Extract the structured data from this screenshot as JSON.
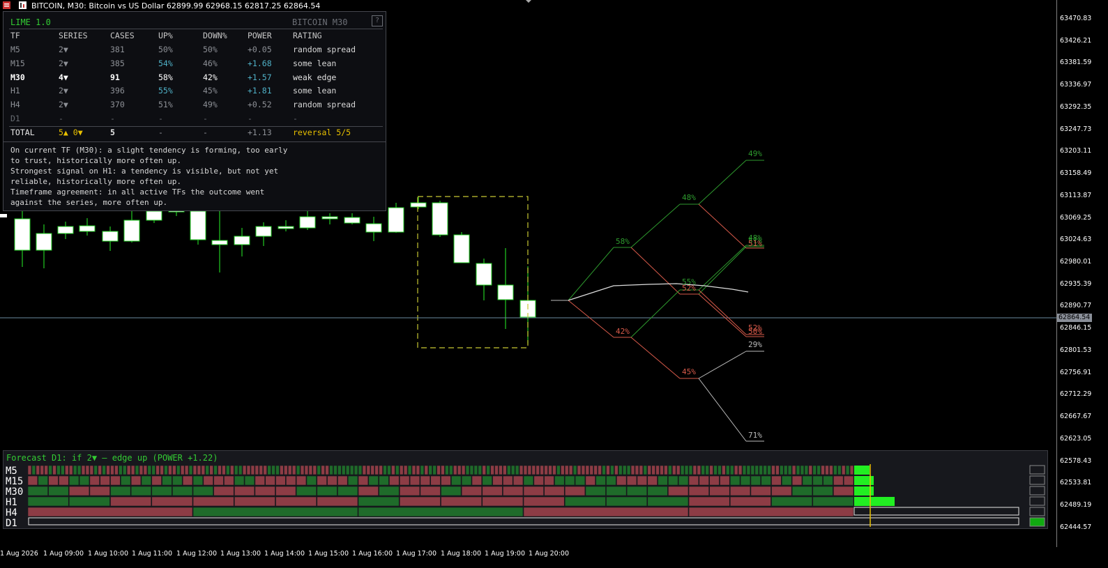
{
  "window": {
    "title": "BITCOIN, M30:  Bitcoin vs US Dollar  62899.99 62968.15 62817.25 62864.54"
  },
  "yaxis": {
    "labels": [
      "63470.83",
      "63426.21",
      "63381.59",
      "63336.97",
      "63292.35",
      "63247.73",
      "63203.11",
      "63158.49",
      "63113.87",
      "63069.25",
      "63024.63",
      "62980.01",
      "62935.39",
      "62890.77",
      "62846.15",
      "62801.53",
      "62756.91",
      "62712.29",
      "62667.67",
      "62623.05",
      "62578.43",
      "62533.81",
      "62489.19",
      "62444.57"
    ],
    "current_price": "62864.54"
  },
  "xaxis": {
    "labels": [
      "1 Aug 2026",
      "1 Aug 09:00",
      "1 Aug 10:00",
      "1 Aug 11:00",
      "1 Aug 12:00",
      "1 Aug 13:00",
      "1 Aug 14:00",
      "1 Aug 15:00",
      "1 Aug 16:00",
      "1 Aug 17:00",
      "1 Aug 18:00",
      "1 Aug 19:00",
      "1 Aug 20:00"
    ]
  },
  "stats_panel": {
    "title": "LIME 1.0",
    "symbol": "BITCOIN  M30",
    "help": "?",
    "headers": [
      "TF",
      "SERIES",
      "CASES",
      "UP%",
      "DOWN%",
      "POWER",
      "RATING"
    ],
    "rows": [
      {
        "tf": "M5",
        "series": "2▼",
        "cases": "381",
        "up": "50%",
        "down": "50%",
        "power": "+0.05",
        "rating": "random spread",
        "hl": false
      },
      {
        "tf": "M15",
        "series": "2▼",
        "cases": "385",
        "up": "54%",
        "down": "46%",
        "power": "+1.68",
        "rating": "some lean",
        "hl": false
      },
      {
        "tf": "M30",
        "series": "4▼",
        "cases": "91",
        "up": "58%",
        "down": "42%",
        "power": "+1.57",
        "rating": "weak edge",
        "hl": true
      },
      {
        "tf": "H1",
        "series": "2▼",
        "cases": "396",
        "up": "55%",
        "down": "45%",
        "power": "+1.81",
        "rating": "some lean",
        "hl": false
      },
      {
        "tf": "H4",
        "series": "2▼",
        "cases": "370",
        "up": "51%",
        "down": "49%",
        "power": "+0.52",
        "rating": "random spread",
        "hl": false
      },
      {
        "tf": "D1",
        "series": "-",
        "cases": "-",
        "up": "-",
        "down": "-",
        "power": "-",
        "rating": "-",
        "hl": false
      }
    ],
    "total": {
      "tf": "TOTAL",
      "series": "5▲ 0▼",
      "cases": "5",
      "up": "-",
      "down": "-",
      "power": "+1.13",
      "rating": "reversal 5/5"
    },
    "notes": [
      "On current TF (M30): a slight tendency is forming, too early",
      "to trust, historically more often up.",
      "Strongest signal on H1: a tendency is visible, but not yet",
      "reliable, historically more often up.",
      "Timeframe agreement: in all active TFs the outcome went",
      "against the series, more often up."
    ]
  },
  "forecast": {
    "title": "Forecast D1: if 2▼ — edge up (POWER +1.22)",
    "rows": [
      "M5",
      "M15",
      "M30",
      "H1",
      "H4",
      "D1"
    ]
  },
  "projection_labels": [
    "58%",
    "42%",
    "48%",
    "55%",
    "52%",
    "45%",
    "49%",
    "48%",
    "51%",
    "51%",
    "52%",
    "50%",
    "29%",
    "71%"
  ],
  "colors": {
    "up": "#22cc22",
    "down": "#d85a4a",
    "heat_up": "#1f6b2a",
    "heat_down": "#8d3c45",
    "box": "#c8c832",
    "accent": "#e8c000"
  },
  "icons": [
    "chart-window-icon",
    "menu-arrow-icon"
  ]
}
